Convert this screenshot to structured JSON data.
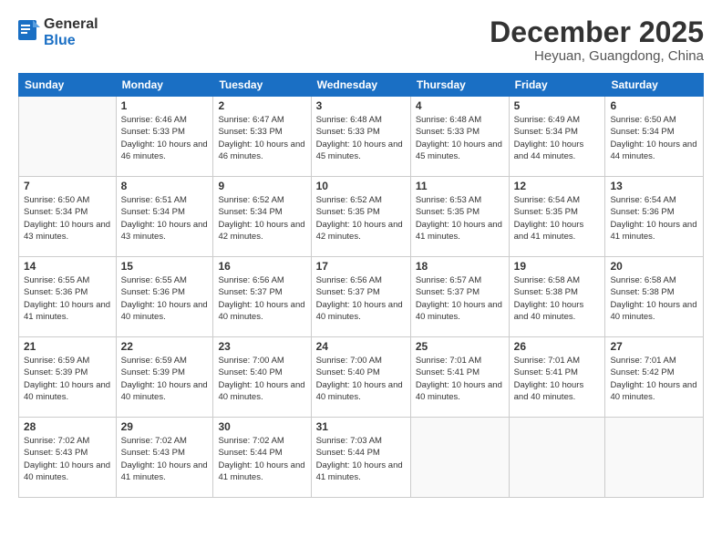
{
  "header": {
    "logo": {
      "general": "General",
      "blue": "Blue"
    },
    "title": "December 2025",
    "location": "Heyuan, Guangdong, China"
  },
  "days_of_week": [
    "Sunday",
    "Monday",
    "Tuesday",
    "Wednesday",
    "Thursday",
    "Friday",
    "Saturday"
  ],
  "weeks": [
    {
      "days": [
        {
          "num": "",
          "empty": true
        },
        {
          "num": "1",
          "sunrise": "6:46 AM",
          "sunset": "5:33 PM",
          "daylight": "10 hours and 46 minutes."
        },
        {
          "num": "2",
          "sunrise": "6:47 AM",
          "sunset": "5:33 PM",
          "daylight": "10 hours and 46 minutes."
        },
        {
          "num": "3",
          "sunrise": "6:48 AM",
          "sunset": "5:33 PM",
          "daylight": "10 hours and 45 minutes."
        },
        {
          "num": "4",
          "sunrise": "6:48 AM",
          "sunset": "5:33 PM",
          "daylight": "10 hours and 45 minutes."
        },
        {
          "num": "5",
          "sunrise": "6:49 AM",
          "sunset": "5:34 PM",
          "daylight": "10 hours and 44 minutes."
        },
        {
          "num": "6",
          "sunrise": "6:50 AM",
          "sunset": "5:34 PM",
          "daylight": "10 hours and 44 minutes."
        }
      ]
    },
    {
      "days": [
        {
          "num": "7",
          "sunrise": "6:50 AM",
          "sunset": "5:34 PM",
          "daylight": "10 hours and 43 minutes."
        },
        {
          "num": "8",
          "sunrise": "6:51 AM",
          "sunset": "5:34 PM",
          "daylight": "10 hours and 43 minutes."
        },
        {
          "num": "9",
          "sunrise": "6:52 AM",
          "sunset": "5:34 PM",
          "daylight": "10 hours and 42 minutes."
        },
        {
          "num": "10",
          "sunrise": "6:52 AM",
          "sunset": "5:35 PM",
          "daylight": "10 hours and 42 minutes."
        },
        {
          "num": "11",
          "sunrise": "6:53 AM",
          "sunset": "5:35 PM",
          "daylight": "10 hours and 41 minutes."
        },
        {
          "num": "12",
          "sunrise": "6:54 AM",
          "sunset": "5:35 PM",
          "daylight": "10 hours and 41 minutes."
        },
        {
          "num": "13",
          "sunrise": "6:54 AM",
          "sunset": "5:36 PM",
          "daylight": "10 hours and 41 minutes."
        }
      ]
    },
    {
      "days": [
        {
          "num": "14",
          "sunrise": "6:55 AM",
          "sunset": "5:36 PM",
          "daylight": "10 hours and 41 minutes."
        },
        {
          "num": "15",
          "sunrise": "6:55 AM",
          "sunset": "5:36 PM",
          "daylight": "10 hours and 40 minutes."
        },
        {
          "num": "16",
          "sunrise": "6:56 AM",
          "sunset": "5:37 PM",
          "daylight": "10 hours and 40 minutes."
        },
        {
          "num": "17",
          "sunrise": "6:56 AM",
          "sunset": "5:37 PM",
          "daylight": "10 hours and 40 minutes."
        },
        {
          "num": "18",
          "sunrise": "6:57 AM",
          "sunset": "5:37 PM",
          "daylight": "10 hours and 40 minutes."
        },
        {
          "num": "19",
          "sunrise": "6:58 AM",
          "sunset": "5:38 PM",
          "daylight": "10 hours and 40 minutes."
        },
        {
          "num": "20",
          "sunrise": "6:58 AM",
          "sunset": "5:38 PM",
          "daylight": "10 hours and 40 minutes."
        }
      ]
    },
    {
      "days": [
        {
          "num": "21",
          "sunrise": "6:59 AM",
          "sunset": "5:39 PM",
          "daylight": "10 hours and 40 minutes."
        },
        {
          "num": "22",
          "sunrise": "6:59 AM",
          "sunset": "5:39 PM",
          "daylight": "10 hours and 40 minutes."
        },
        {
          "num": "23",
          "sunrise": "7:00 AM",
          "sunset": "5:40 PM",
          "daylight": "10 hours and 40 minutes."
        },
        {
          "num": "24",
          "sunrise": "7:00 AM",
          "sunset": "5:40 PM",
          "daylight": "10 hours and 40 minutes."
        },
        {
          "num": "25",
          "sunrise": "7:01 AM",
          "sunset": "5:41 PM",
          "daylight": "10 hours and 40 minutes."
        },
        {
          "num": "26",
          "sunrise": "7:01 AM",
          "sunset": "5:41 PM",
          "daylight": "10 hours and 40 minutes."
        },
        {
          "num": "27",
          "sunrise": "7:01 AM",
          "sunset": "5:42 PM",
          "daylight": "10 hours and 40 minutes."
        }
      ]
    },
    {
      "days": [
        {
          "num": "28",
          "sunrise": "7:02 AM",
          "sunset": "5:43 PM",
          "daylight": "10 hours and 40 minutes."
        },
        {
          "num": "29",
          "sunrise": "7:02 AM",
          "sunset": "5:43 PM",
          "daylight": "10 hours and 41 minutes."
        },
        {
          "num": "30",
          "sunrise": "7:02 AM",
          "sunset": "5:44 PM",
          "daylight": "10 hours and 41 minutes."
        },
        {
          "num": "31",
          "sunrise": "7:03 AM",
          "sunset": "5:44 PM",
          "daylight": "10 hours and 41 minutes."
        },
        {
          "num": "",
          "empty": true
        },
        {
          "num": "",
          "empty": true
        },
        {
          "num": "",
          "empty": true
        }
      ]
    }
  ]
}
